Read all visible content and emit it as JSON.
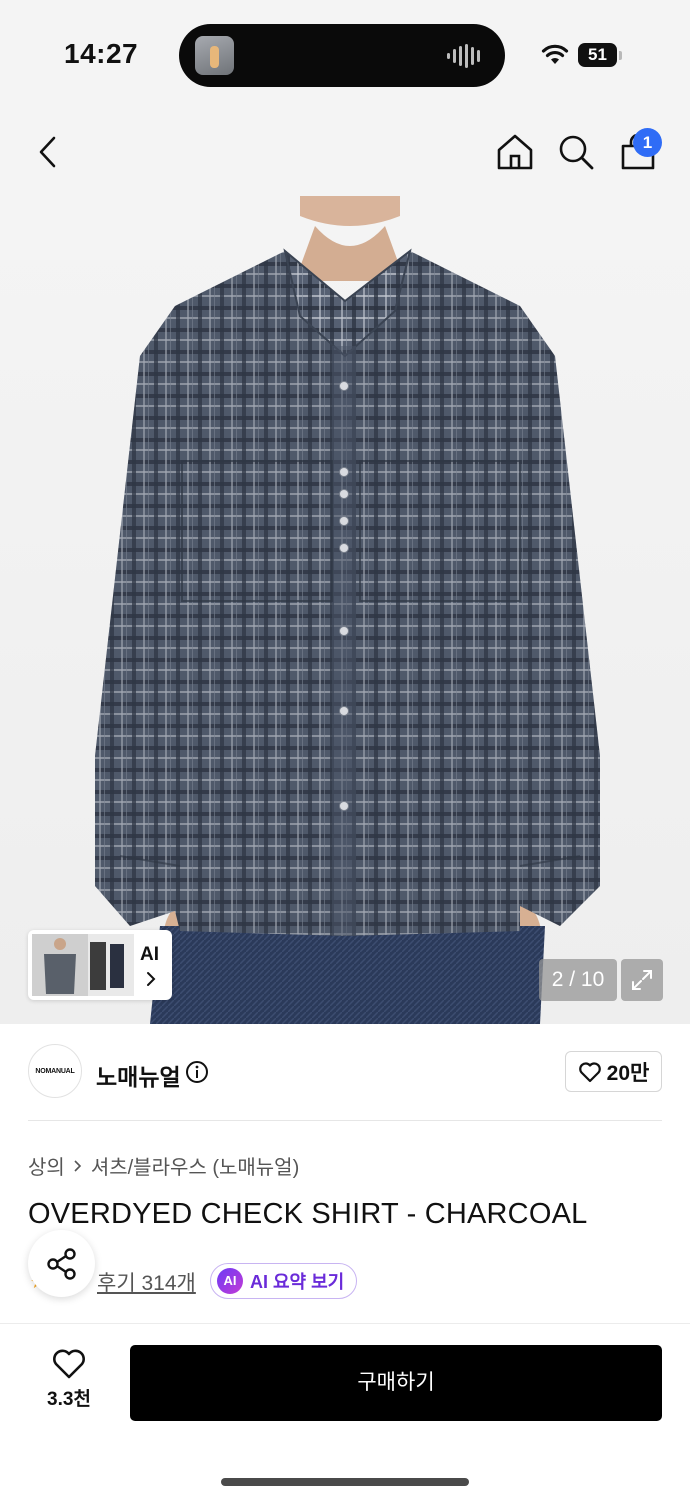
{
  "status_bar": {
    "time": "14:27",
    "battery": "51"
  },
  "nav": {
    "cart_badge": "1",
    "icons": [
      "back-icon",
      "home-icon",
      "search-icon",
      "cart-icon"
    ]
  },
  "gallery": {
    "counter": "2 / 10",
    "thumb_ai_label": "AI"
  },
  "brand": {
    "logo_text": "NOMANUAL",
    "name": "노매뉴얼",
    "likes": "20만"
  },
  "product": {
    "breadcrumb": [
      "상의",
      "셔츠/블라우스 (노매뉴얼)"
    ],
    "title": "OVERDYED CHECK SHIRT - CHARCOAL",
    "reviews": "후기 314개",
    "ai_icon": "AI",
    "ai_summary": "AI 요약 보기"
  },
  "bottom": {
    "wish_count": "3.3천",
    "buy_label": "구매하기"
  },
  "colors": {
    "accent_blue": "#2f6cf6",
    "ai_purple": "#6a2bd9",
    "shirt": "#4b5566"
  }
}
